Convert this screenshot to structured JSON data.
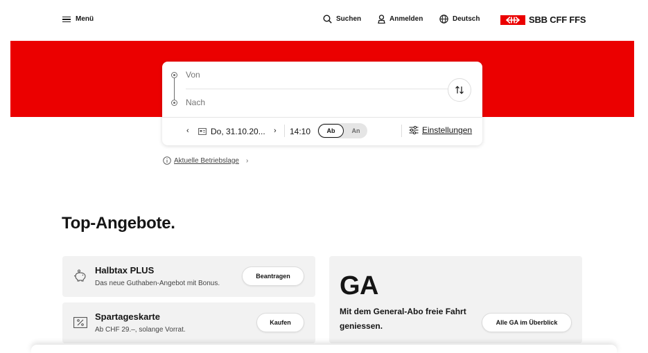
{
  "header": {
    "menu_label": "Menü",
    "search_label": "Suchen",
    "login_label": "Anmelden",
    "language_label": "Deutsch",
    "logo_text": "SBB CFF FFS"
  },
  "colors": {
    "brand_red": "#eb0000",
    "text": "#151515",
    "card_bg": "#f2f2f2"
  },
  "search": {
    "from_placeholder": "Von",
    "to_placeholder": "Nach",
    "date": "Do, 31.10.20...",
    "time": "14:10",
    "toggle_departure": "Ab",
    "toggle_arrival": "An",
    "toggle_selected": "Ab",
    "settings_label": "Einstellungen"
  },
  "status_link": {
    "label": "Aktuelle Betriebslage"
  },
  "offers": {
    "title": "Top-Angebote.",
    "items": [
      {
        "icon": "piggy-bank-icon",
        "title": "Halbtax PLUS",
        "subtitle": "Das neue Guthaben-Angebot mit Bonus.",
        "button": "Beantragen"
      },
      {
        "icon": "percent-ticket-icon",
        "title": "Spartageskarte",
        "subtitle": "Ab CHF 29.–, solange Vorrat.",
        "button": "Kaufen"
      }
    ],
    "ga": {
      "title": "GA",
      "text": "Mit dem General-Abo freie Fahrt geniessen.",
      "button": "Alle GA im Überblick"
    }
  }
}
